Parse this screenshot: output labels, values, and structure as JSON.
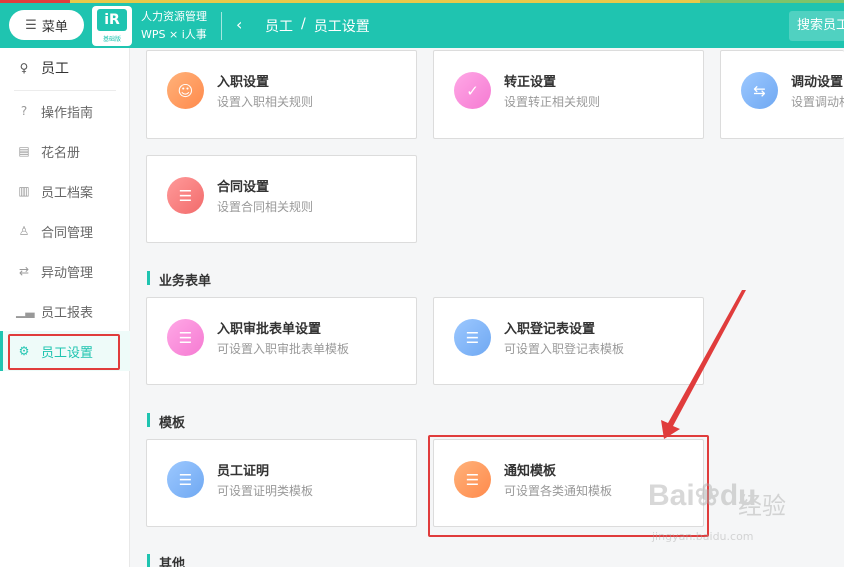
{
  "header": {
    "menu_icon": "list-icon",
    "menu_label": "菜单",
    "logo_mark": "iR",
    "logo_sub": "基础版",
    "app_title": "人力资源管理",
    "app_sub": "WPS × i人事",
    "back_icon": "chevron-left-icon",
    "breadcrumb": [
      "员工",
      "员工设置"
    ],
    "breadcrumb_sep": "/",
    "search_text": "搜索员工"
  },
  "sidebar": {
    "head": {
      "icon": "person-icon",
      "label": "员工"
    },
    "items": [
      {
        "icon": "question-circle-icon",
        "label": "操作指南"
      },
      {
        "icon": "roster-icon",
        "label": "花名册"
      },
      {
        "icon": "file-icon",
        "label": "员工档案"
      },
      {
        "icon": "contract-icon",
        "label": "合同管理"
      },
      {
        "icon": "change-icon",
        "label": "异动管理"
      },
      {
        "icon": "chart-icon",
        "label": "员工报表"
      },
      {
        "icon": "gear-icon",
        "label": "员工设置"
      }
    ],
    "active_index": 6
  },
  "cards": {
    "onboard": {
      "title": "入职设置",
      "desc": "设置入职相关规则",
      "icon": "user-add-icon"
    },
    "regular": {
      "title": "转正设置",
      "desc": "设置转正相关规则",
      "icon": "user-check-icon"
    },
    "transfer": {
      "title": "调动设置",
      "desc": "设置调动相关规则",
      "icon": "user-transfer-icon"
    },
    "contract": {
      "title": "合同设置",
      "desc": "设置合同相关规则",
      "icon": "contract-icon"
    },
    "approval_form": {
      "title": "入职审批表单设置",
      "desc": "可设置入职审批表单模板",
      "icon": "form-icon"
    },
    "register_form": {
      "title": "入职登记表设置",
      "desc": "可设置入职登记表模板",
      "icon": "register-icon"
    },
    "certificate": {
      "title": "员工证明",
      "desc": "可设置证明类模板",
      "icon": "certificate-icon"
    },
    "notice": {
      "title": "通知模板",
      "desc": "可设置各类通知模板",
      "icon": "notice-icon"
    }
  },
  "sections": {
    "business_forms": "业务表单",
    "templates": "模板",
    "other": "其他"
  },
  "watermark": {
    "logo": "Bai",
    "logo_paw": "du",
    "text": "经验",
    "url": "jingyan.baidu.com"
  },
  "colors": {
    "accent": "#1fc4b0",
    "highlight": "#e03c3c"
  }
}
